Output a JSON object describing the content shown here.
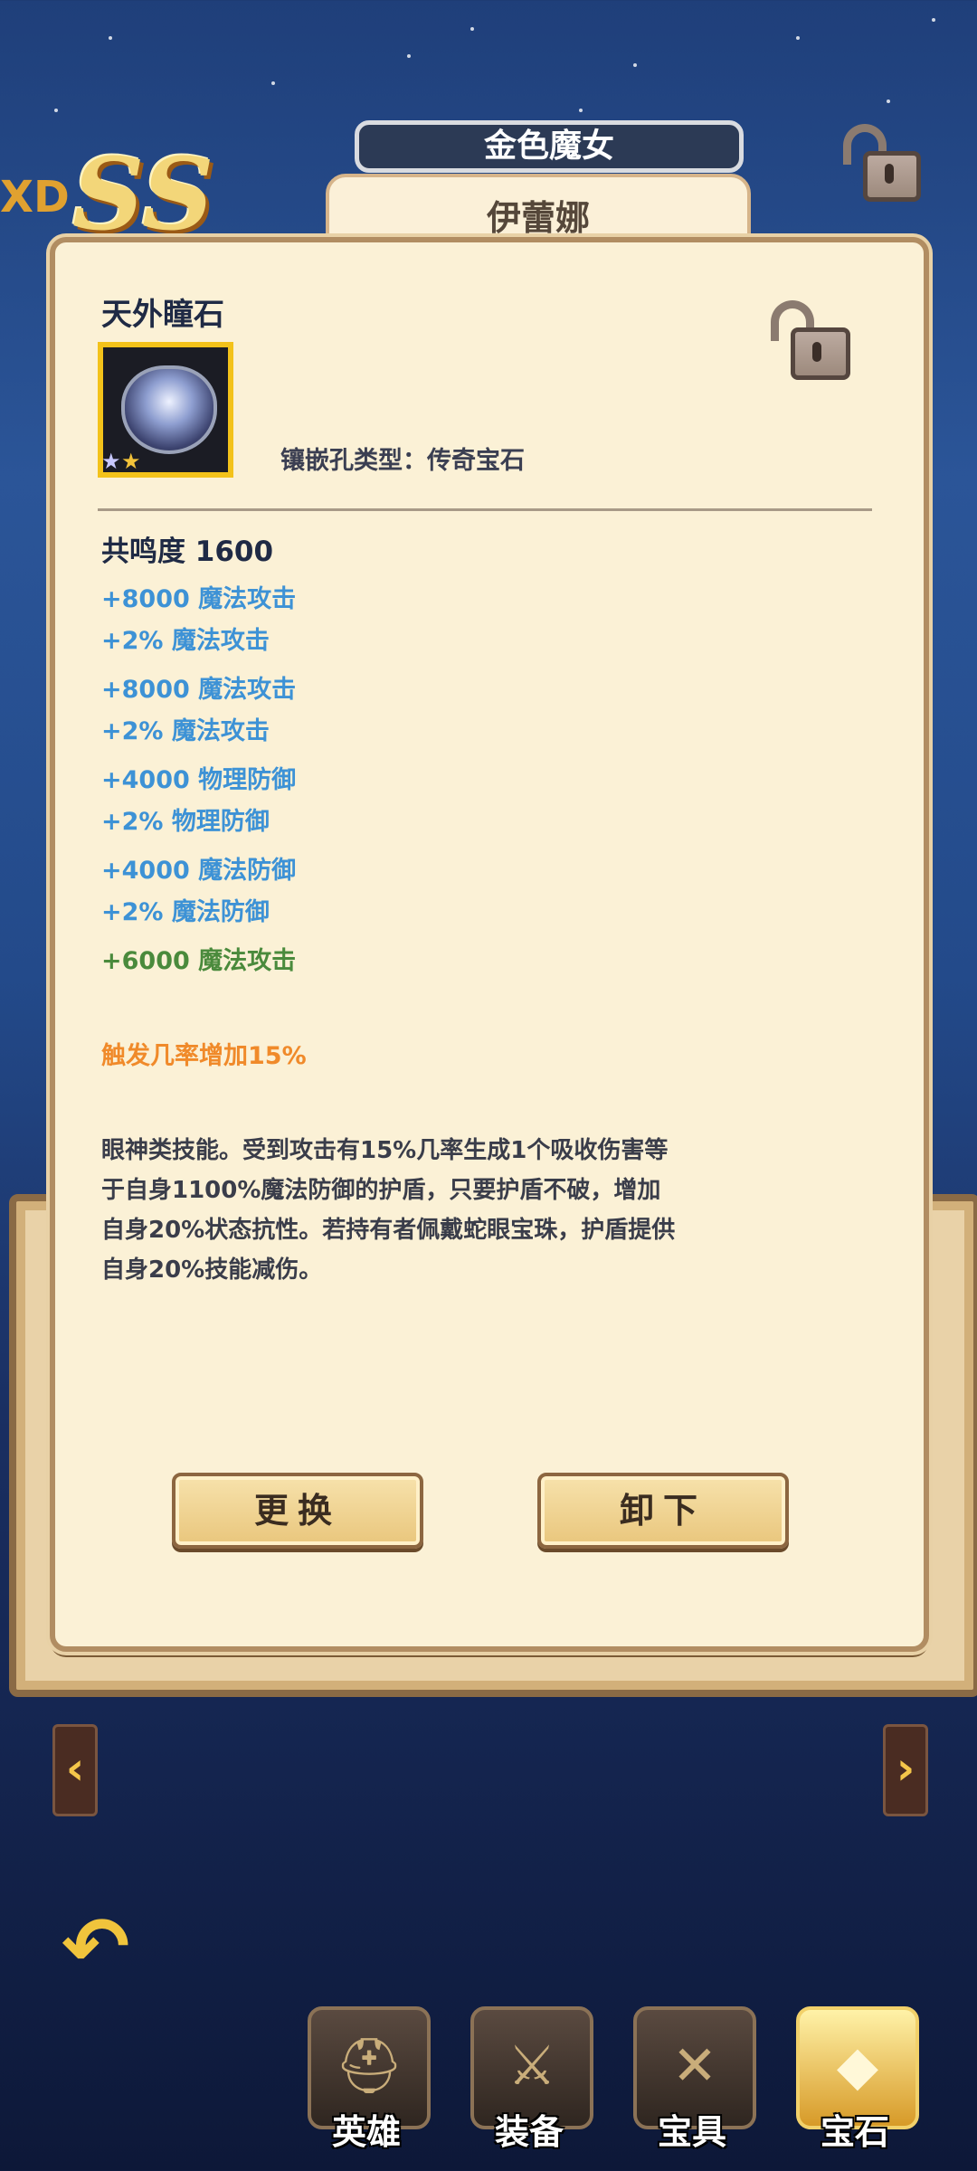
{
  "header": {
    "edge_text": "XD",
    "rank": "SS",
    "hero_title": "金色魔女",
    "hero_name": "伊蕾娜"
  },
  "gem": {
    "name": "天外瞳石",
    "socket_type": "镶嵌孔类型：传奇宝石",
    "stars": 2,
    "resonance": "共鸣度 1600"
  },
  "stats": [
    {
      "text": "+8000 魔法攻击",
      "color": "blue"
    },
    {
      "text": "+2% 魔法攻击",
      "color": "blue"
    },
    {
      "text": "+8000 魔法攻击",
      "color": "blue"
    },
    {
      "text": "+2% 魔法攻击",
      "color": "blue"
    },
    {
      "text": "+4000 物理防御",
      "color": "blue"
    },
    {
      "text": "+2% 物理防御",
      "color": "blue"
    },
    {
      "text": "+4000 魔法防御",
      "color": "blue"
    },
    {
      "text": "+2% 魔法防御",
      "color": "blue"
    },
    {
      "text": "+6000 魔法攻击",
      "color": "green"
    }
  ],
  "trigger": "触发几率增加15%",
  "description": "眼神类技能。受到攻击有15%几率生成1个吸收伤害等于自身1100%魔法防御的护盾，只要护盾不破，增加自身20%状态抗性。若持有者佩戴蛇眼宝珠，护盾提供自身20%技能减伤。",
  "buttons": {
    "replace": "更换",
    "unequip": "卸下"
  },
  "arrows": {
    "left": "‹",
    "right": "›"
  },
  "nav": {
    "items": [
      {
        "label": "英雄",
        "icon": "helmet-icon"
      },
      {
        "label": "装备",
        "icon": "shield-sword-icon"
      },
      {
        "label": "宝具",
        "icon": "crossed-swords-icon"
      },
      {
        "label": "宝石",
        "icon": "gem-icon"
      }
    ],
    "active": "宝石"
  },
  "colors": {
    "stat_blue": "#3d92d6",
    "stat_green": "#4a8a3c",
    "trigger_orange": "#f08a2a",
    "card_bg": "#fbf1d6"
  }
}
